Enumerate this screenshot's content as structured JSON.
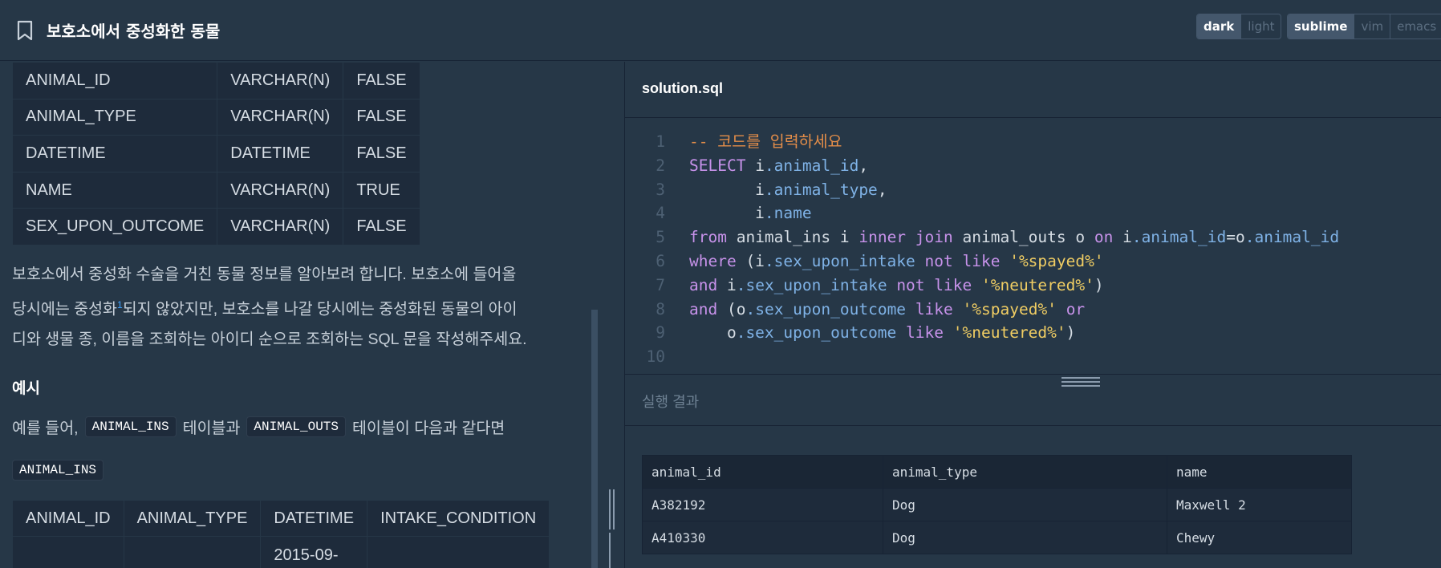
{
  "header": {
    "title": "보호소에서 중성화한 동물",
    "theme_options": [
      "dark",
      "light"
    ],
    "theme_selected": "dark",
    "keymap_options": [
      "sublime",
      "vim",
      "emacs"
    ],
    "keymap_selected": "sublime"
  },
  "schema_table": {
    "rows": [
      [
        "ANIMAL_ID",
        "VARCHAR(N)",
        "FALSE"
      ],
      [
        "ANIMAL_TYPE",
        "VARCHAR(N)",
        "FALSE"
      ],
      [
        "DATETIME",
        "DATETIME",
        "FALSE"
      ],
      [
        "NAME",
        "VARCHAR(N)",
        "TRUE"
      ],
      [
        "SEX_UPON_OUTCOME",
        "VARCHAR(N)",
        "FALSE"
      ]
    ]
  },
  "description": {
    "line1": "보호소에서 중성화 수술을 거친 동물 정보를 알아보려 합니다. 보호소에 들어올",
    "line2a": "당시에는 중성화",
    "footnote": "1",
    "line2b": "되지 않았지만, 보호소를 나갈 당시에는 중성화된 동물의 아이",
    "line3": "디와 생물 종, 이름을 조회하는 아이디 순으로 조회하는 SQL 문을 작성해주세요."
  },
  "example": {
    "heading": "예시",
    "text_before": "예를 들어,",
    "chip1": "ANIMAL_INS",
    "text_middle": "테이블과",
    "chip2": "ANIMAL_OUTS",
    "text_after": "테이블이 다음과 같다면",
    "table_label": "ANIMAL_INS",
    "sample_headers": [
      "ANIMAL_ID",
      "ANIMAL_TYPE",
      "DATETIME",
      "INTAKE_CONDITION"
    ],
    "sample_row_partial": [
      "",
      "",
      "2015-09-",
      ""
    ]
  },
  "editor": {
    "file_name": "solution.sql",
    "line_numbers": [
      "1",
      "2",
      "3",
      "4",
      "5",
      "6",
      "7",
      "8",
      "9",
      "10"
    ],
    "lines": [
      [
        {
          "t": "-- 코드를 입력하세요",
          "c": "comment"
        }
      ],
      [
        {
          "t": "SELECT",
          "c": "kw"
        },
        {
          "t": " i",
          "c": ""
        },
        {
          "t": ".animal_id",
          "c": "prop"
        },
        {
          "t": ",",
          "c": ""
        }
      ],
      [
        {
          "t": "       i",
          "c": ""
        },
        {
          "t": ".animal_type",
          "c": "prop"
        },
        {
          "t": ",",
          "c": ""
        }
      ],
      [
        {
          "t": "       i",
          "c": ""
        },
        {
          "t": ".name",
          "c": "prop"
        }
      ],
      [
        {
          "t": "from",
          "c": "kw"
        },
        {
          "t": " animal_ins i ",
          "c": ""
        },
        {
          "t": "inner join",
          "c": "kw"
        },
        {
          "t": " animal_outs o ",
          "c": ""
        },
        {
          "t": "on",
          "c": "kw"
        },
        {
          "t": " i",
          "c": ""
        },
        {
          "t": ".animal_id",
          "c": "prop"
        },
        {
          "t": "=o",
          "c": ""
        },
        {
          "t": ".animal_id",
          "c": "prop"
        }
      ],
      [
        {
          "t": "where",
          "c": "kw"
        },
        {
          "t": " (i",
          "c": ""
        },
        {
          "t": ".sex_upon_intake",
          "c": "prop"
        },
        {
          "t": " ",
          "c": ""
        },
        {
          "t": "not like",
          "c": "kw"
        },
        {
          "t": " ",
          "c": ""
        },
        {
          "t": "'%spayed%'",
          "c": "str"
        }
      ],
      [
        {
          "t": "and",
          "c": "kw"
        },
        {
          "t": " i",
          "c": ""
        },
        {
          "t": ".sex_upon_intake",
          "c": "prop"
        },
        {
          "t": " ",
          "c": ""
        },
        {
          "t": "not like",
          "c": "kw"
        },
        {
          "t": " ",
          "c": ""
        },
        {
          "t": "'%neutered%'",
          "c": "str"
        },
        {
          "t": ")",
          "c": ""
        }
      ],
      [
        {
          "t": "and",
          "c": "kw"
        },
        {
          "t": " (o",
          "c": ""
        },
        {
          "t": ".sex_upon_outcome",
          "c": "prop"
        },
        {
          "t": " ",
          "c": ""
        },
        {
          "t": "like",
          "c": "kw"
        },
        {
          "t": " ",
          "c": ""
        },
        {
          "t": "'%spayed%'",
          "c": "str"
        },
        {
          "t": " ",
          "c": ""
        },
        {
          "t": "or",
          "c": "kw"
        }
      ],
      [
        {
          "t": "    o",
          "c": ""
        },
        {
          "t": ".sex_upon_outcome",
          "c": "prop"
        },
        {
          "t": " ",
          "c": ""
        },
        {
          "t": "like",
          "c": "kw"
        },
        {
          "t": " ",
          "c": ""
        },
        {
          "t": "'%neutered%'",
          "c": "str"
        },
        {
          "t": ")",
          "c": ""
        }
      ],
      [
        {
          "t": "",
          "c": ""
        }
      ]
    ]
  },
  "result": {
    "label": "실행 결과",
    "headers": [
      "animal_id",
      "animal_type",
      "name"
    ],
    "rows": [
      [
        "A382192",
        "Dog",
        "Maxwell 2"
      ],
      [
        "A410330",
        "Dog",
        "Chewy"
      ]
    ]
  },
  "colors": {
    "background": "#263747",
    "panel_dark": "#1e2b3b",
    "keyword": "#c792ea",
    "property": "#7fb2e6",
    "string": "#f0cd63",
    "comment": "#e38d49"
  }
}
